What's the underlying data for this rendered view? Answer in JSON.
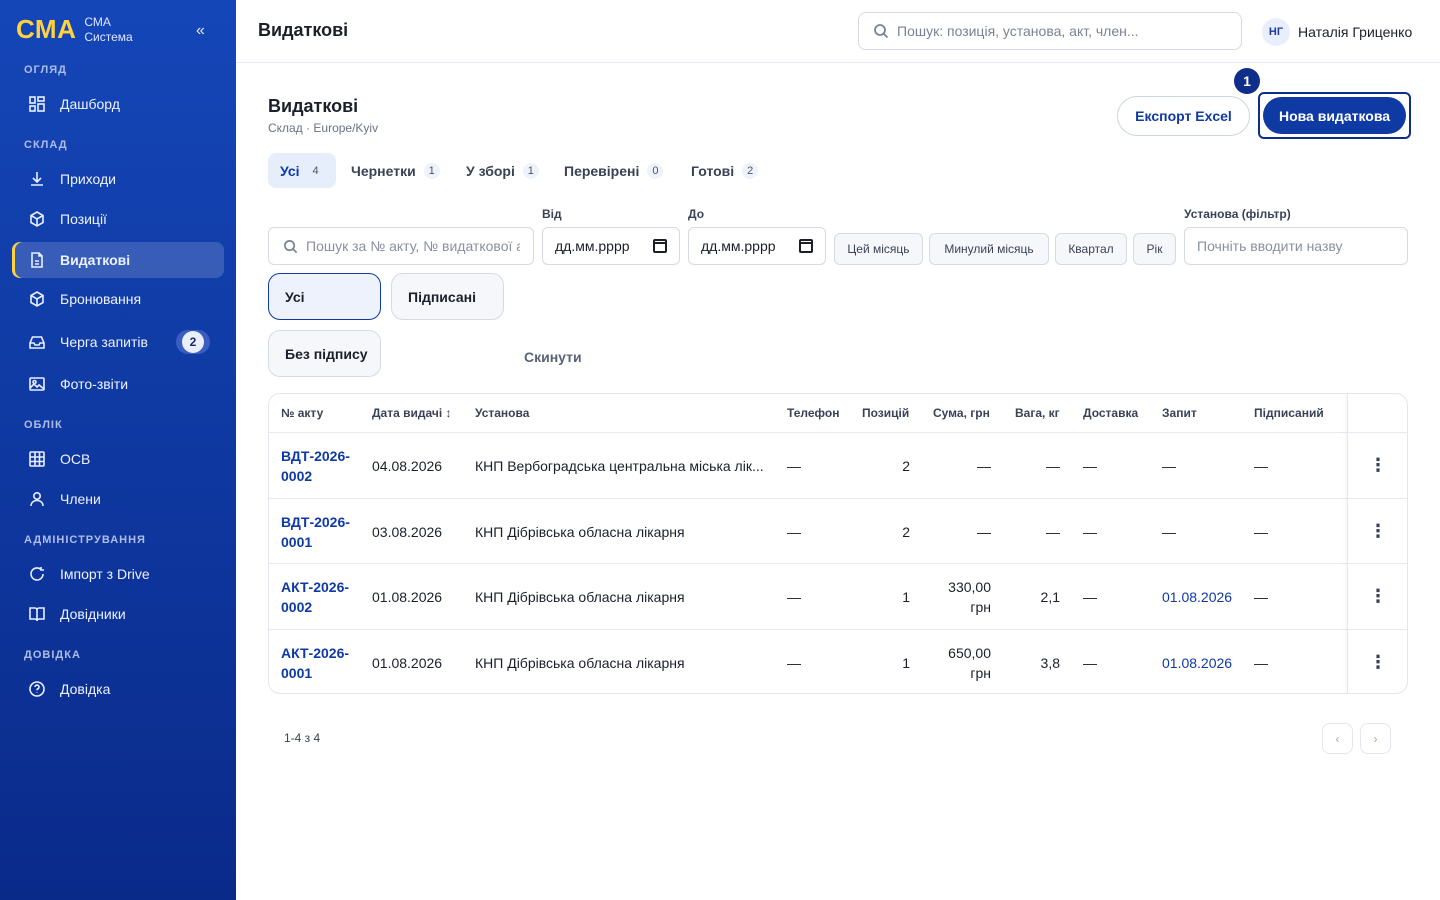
{
  "brand": {
    "logo": "СМА",
    "line1": "СМА",
    "line2": "Система",
    "collapse": "«"
  },
  "nav": {
    "sections": [
      "ОГЛЯД",
      "СКЛАД",
      "ОБЛІК",
      "АДМІНІСТРУВАННЯ",
      "ДОВІДКА"
    ],
    "items": [
      {
        "label": "Дашборд",
        "icon": "grid-icon"
      },
      {
        "label": "Приходи",
        "icon": "download-icon"
      },
      {
        "label": "Позиції",
        "icon": "box-icon"
      },
      {
        "label": "Видаткові",
        "icon": "document-icon",
        "active": true
      },
      {
        "label": "Бронювання",
        "icon": "box-icon"
      },
      {
        "label": "Черга запитів",
        "icon": "inbox-icon",
        "badge": "2"
      },
      {
        "label": "Фото-звіти",
        "icon": "image-icon"
      },
      {
        "label": "ОСВ",
        "icon": "table-icon"
      },
      {
        "label": "Члени",
        "icon": "user-icon"
      },
      {
        "label": "Імпорт з Drive",
        "icon": "refresh-icon"
      },
      {
        "label": "Довідники",
        "icon": "book-icon"
      },
      {
        "label": "Довідка",
        "icon": "help-icon"
      }
    ]
  },
  "topbar": {
    "title": "Видаткові",
    "search_placeholder": "Пошук: позиція, установа, акт, член...",
    "user_initials": "НГ",
    "user_name": "Наталія Гриценко"
  },
  "page": {
    "title": "Видаткові",
    "subtitle": "Склад · Europe/Kyiv",
    "export_label": "Експорт Excel",
    "new_label": "Нова видаткова",
    "marker": "1"
  },
  "tabs": [
    {
      "label": "Усі",
      "count": "4",
      "active": true
    },
    {
      "label": "Чернетки",
      "count": "1"
    },
    {
      "label": "У зборі",
      "count": "1"
    },
    {
      "label": "Перевірені",
      "count": "0"
    },
    {
      "label": "Готові",
      "count": "2"
    }
  ],
  "filters": {
    "search_placeholder": "Пошук за № акту, № видаткової а",
    "from_label": "Від",
    "to_label": "До",
    "date_placeholder": "дд.мм.рррр",
    "chips": [
      "Цей місяць",
      "Минулий місяць",
      "Квартал",
      "Рік"
    ],
    "institution_label": "Установа (фільтр)",
    "institution_placeholder": "Почніть вводити назву",
    "segments": [
      "Усі",
      "Підписані",
      "Без підпису"
    ],
    "reset_label": "Скинути"
  },
  "table": {
    "headers": [
      "№ акту",
      "Дата видачі ↕",
      "Установа",
      "Телефон",
      "Позицій",
      "Сума, грн",
      "Вага, кг",
      "Доставка",
      "Запит",
      "Підписаний"
    ],
    "rows": [
      {
        "act": "ВДТ-2026-0002",
        "date": "04.08.2026",
        "institution": "КНП Вербоградська центральна міська лік...",
        "phone": "—",
        "positions": "2",
        "sum": "—",
        "weight": "—",
        "delivery": "—",
        "request": "—",
        "signed": "—"
      },
      {
        "act": "ВДТ-2026-0001",
        "date": "03.08.2026",
        "institution": "КНП Дібрівська обласна лікарня",
        "phone": "—",
        "positions": "2",
        "sum": "—",
        "weight": "—",
        "delivery": "—",
        "request": "—",
        "signed": "—"
      },
      {
        "act": "АКТ-2026-0002",
        "date": "01.08.2026",
        "institution": "КНП Дібрівська обласна лікарня",
        "phone": "—",
        "positions": "1",
        "sum": "330,00 грн",
        "weight": "2,1",
        "delivery": "—",
        "request": "01.08.2026",
        "signed": "—"
      },
      {
        "act": "АКТ-2026-0001",
        "date": "01.08.2026",
        "institution": "КНП Дібрівська обласна лікарня",
        "phone": "—",
        "positions": "1",
        "sum": "650,00 грн",
        "weight": "3,8",
        "delivery": "—",
        "request": "01.08.2026",
        "signed": "—"
      }
    ],
    "kebab": "⋮"
  },
  "pager": {
    "info": "1-4 з 4",
    "prev": "‹",
    "next": "›"
  },
  "colors": {
    "sidebar": "#1546b8",
    "accent": "#0f3aa3",
    "brand_yellow": "#ffd23f"
  }
}
